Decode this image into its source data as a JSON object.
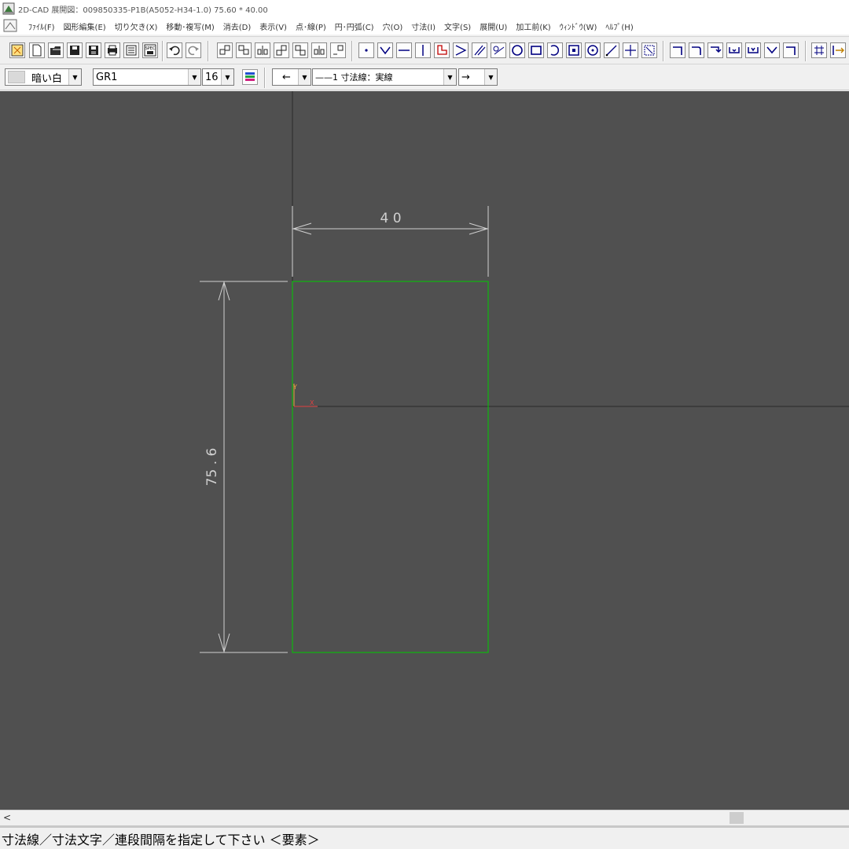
{
  "window": {
    "title": "2D-CAD 展開図：009850335-P1B(A5052-H34-1.0) 75.60 * 40.00"
  },
  "menu": {
    "items": [
      "ﾌｧｲﾙ(F)",
      "図形編集(E)",
      "切り欠き(X)",
      "移動･複写(M)",
      "消去(D)",
      "表示(V)",
      "点･線(P)",
      "円･円弧(C)",
      "穴(O)",
      "寸法(I)",
      "文字(S)",
      "展開(U)",
      "加工前(K)",
      "ｳｨﾝﾄﾞｳ(W)",
      "ﾍﾙﾌﾟ(H)"
    ]
  },
  "toolbar2": {
    "color_value": "暗い白",
    "layer_value": "GR1",
    "pen_value": "16",
    "arrow_start_value": "←",
    "linetype_value": "——1 寸法線：実線",
    "arrow_end_value": "→"
  },
  "drawing": {
    "dim_width_label": "4 0",
    "dim_height_label": "75 . 6",
    "part_width": 40,
    "part_height": 75.6,
    "colors": {
      "background": "#505050",
      "outline": "#00cc00",
      "dimension": "#d0d0d0",
      "origin_y": "#e8a040",
      "origin_x": "#e04040"
    },
    "origin_axis_y_label": "Y",
    "origin_axis_x_label": "X"
  },
  "statusbar": {
    "message": "寸法線／寸法文字／連段間隔を指定して下さい ＜要素＞"
  }
}
